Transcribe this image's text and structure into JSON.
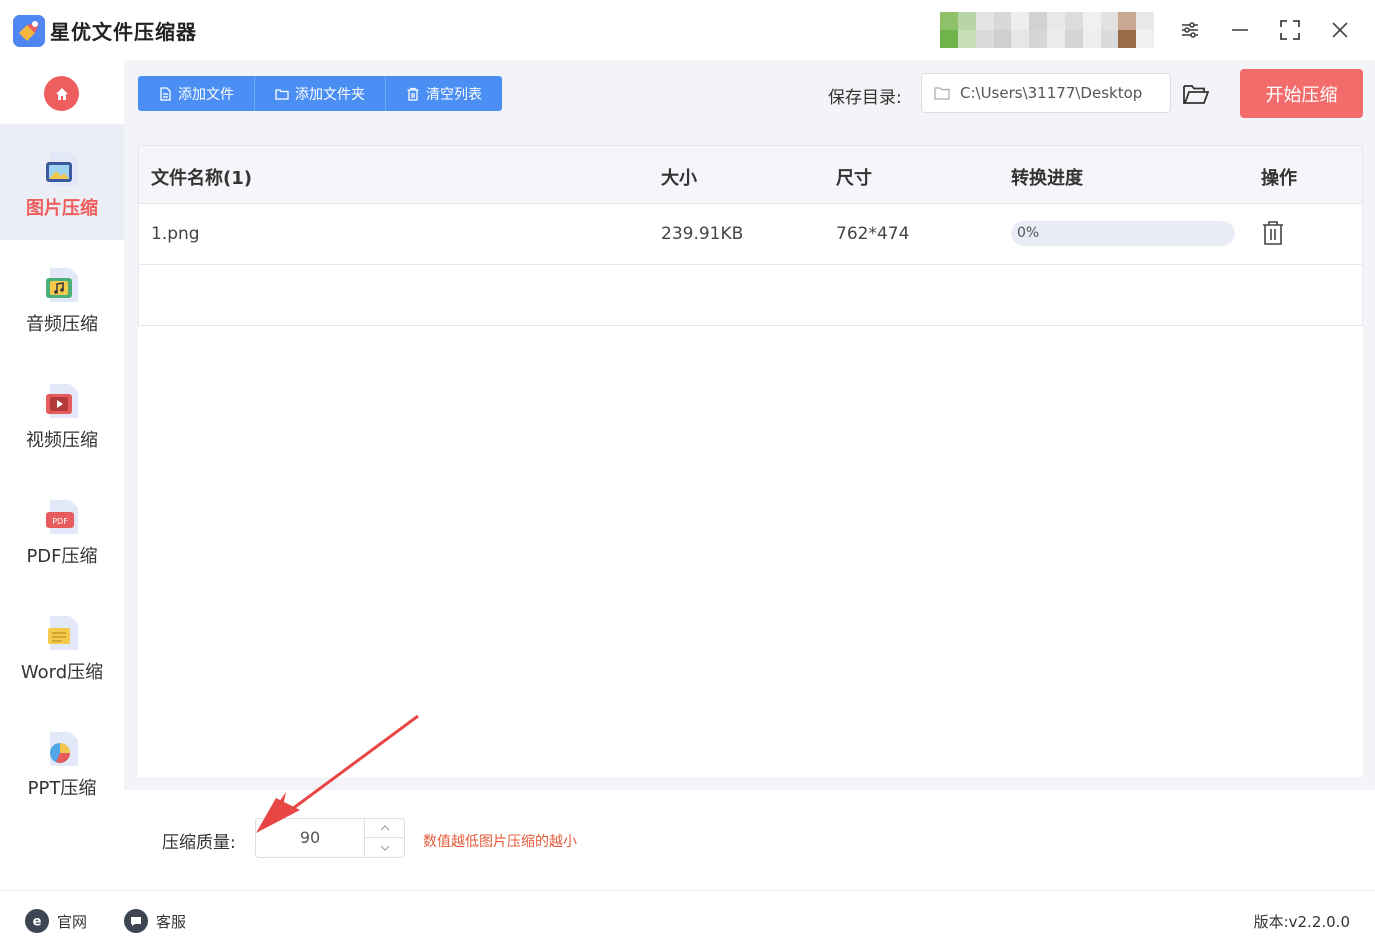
{
  "app": {
    "title": "星优文件压缩器"
  },
  "window": {
    "controls": [
      "settings-icon",
      "minimize-icon",
      "maximize-icon",
      "close-icon"
    ]
  },
  "sidebar": {
    "items": [
      {
        "label": "图片压缩",
        "icon": "image-file-icon",
        "active": true
      },
      {
        "label": "音频压缩",
        "icon": "audio-file-icon",
        "active": false
      },
      {
        "label": "视频压缩",
        "icon": "video-file-icon",
        "active": false
      },
      {
        "label": "PDF压缩",
        "icon": "pdf-file-icon",
        "active": false
      },
      {
        "label": "Word压缩",
        "icon": "word-file-icon",
        "active": false
      },
      {
        "label": "PPT压缩",
        "icon": "ppt-file-icon",
        "active": false
      }
    ]
  },
  "toolbar": {
    "add_file": "添加文件",
    "add_folder": "添加文件夹",
    "clear_list": "清空列表",
    "save_label": "保存目录:",
    "save_path": "C:\\Users\\31177\\Desktop",
    "start": "开始压缩"
  },
  "table": {
    "headers": [
      "文件名称(1)",
      "大小",
      "尺寸",
      "转换进度",
      "操作"
    ],
    "rows": [
      {
        "name": "1.png",
        "size": "239.91KB",
        "dimensions": "762*474",
        "progress_text": "0%",
        "progress": 0
      }
    ]
  },
  "quality": {
    "label": "压缩质量:",
    "value": "90",
    "hint": "数值越低图片压缩的越小"
  },
  "footer": {
    "website": "官网",
    "support": "客服",
    "version": "版本:v2.2.0.0"
  },
  "colors": {
    "accent_blue": "#4b8ff5",
    "accent_red": "#f36c6c",
    "hint_red": "#e55b3a"
  }
}
